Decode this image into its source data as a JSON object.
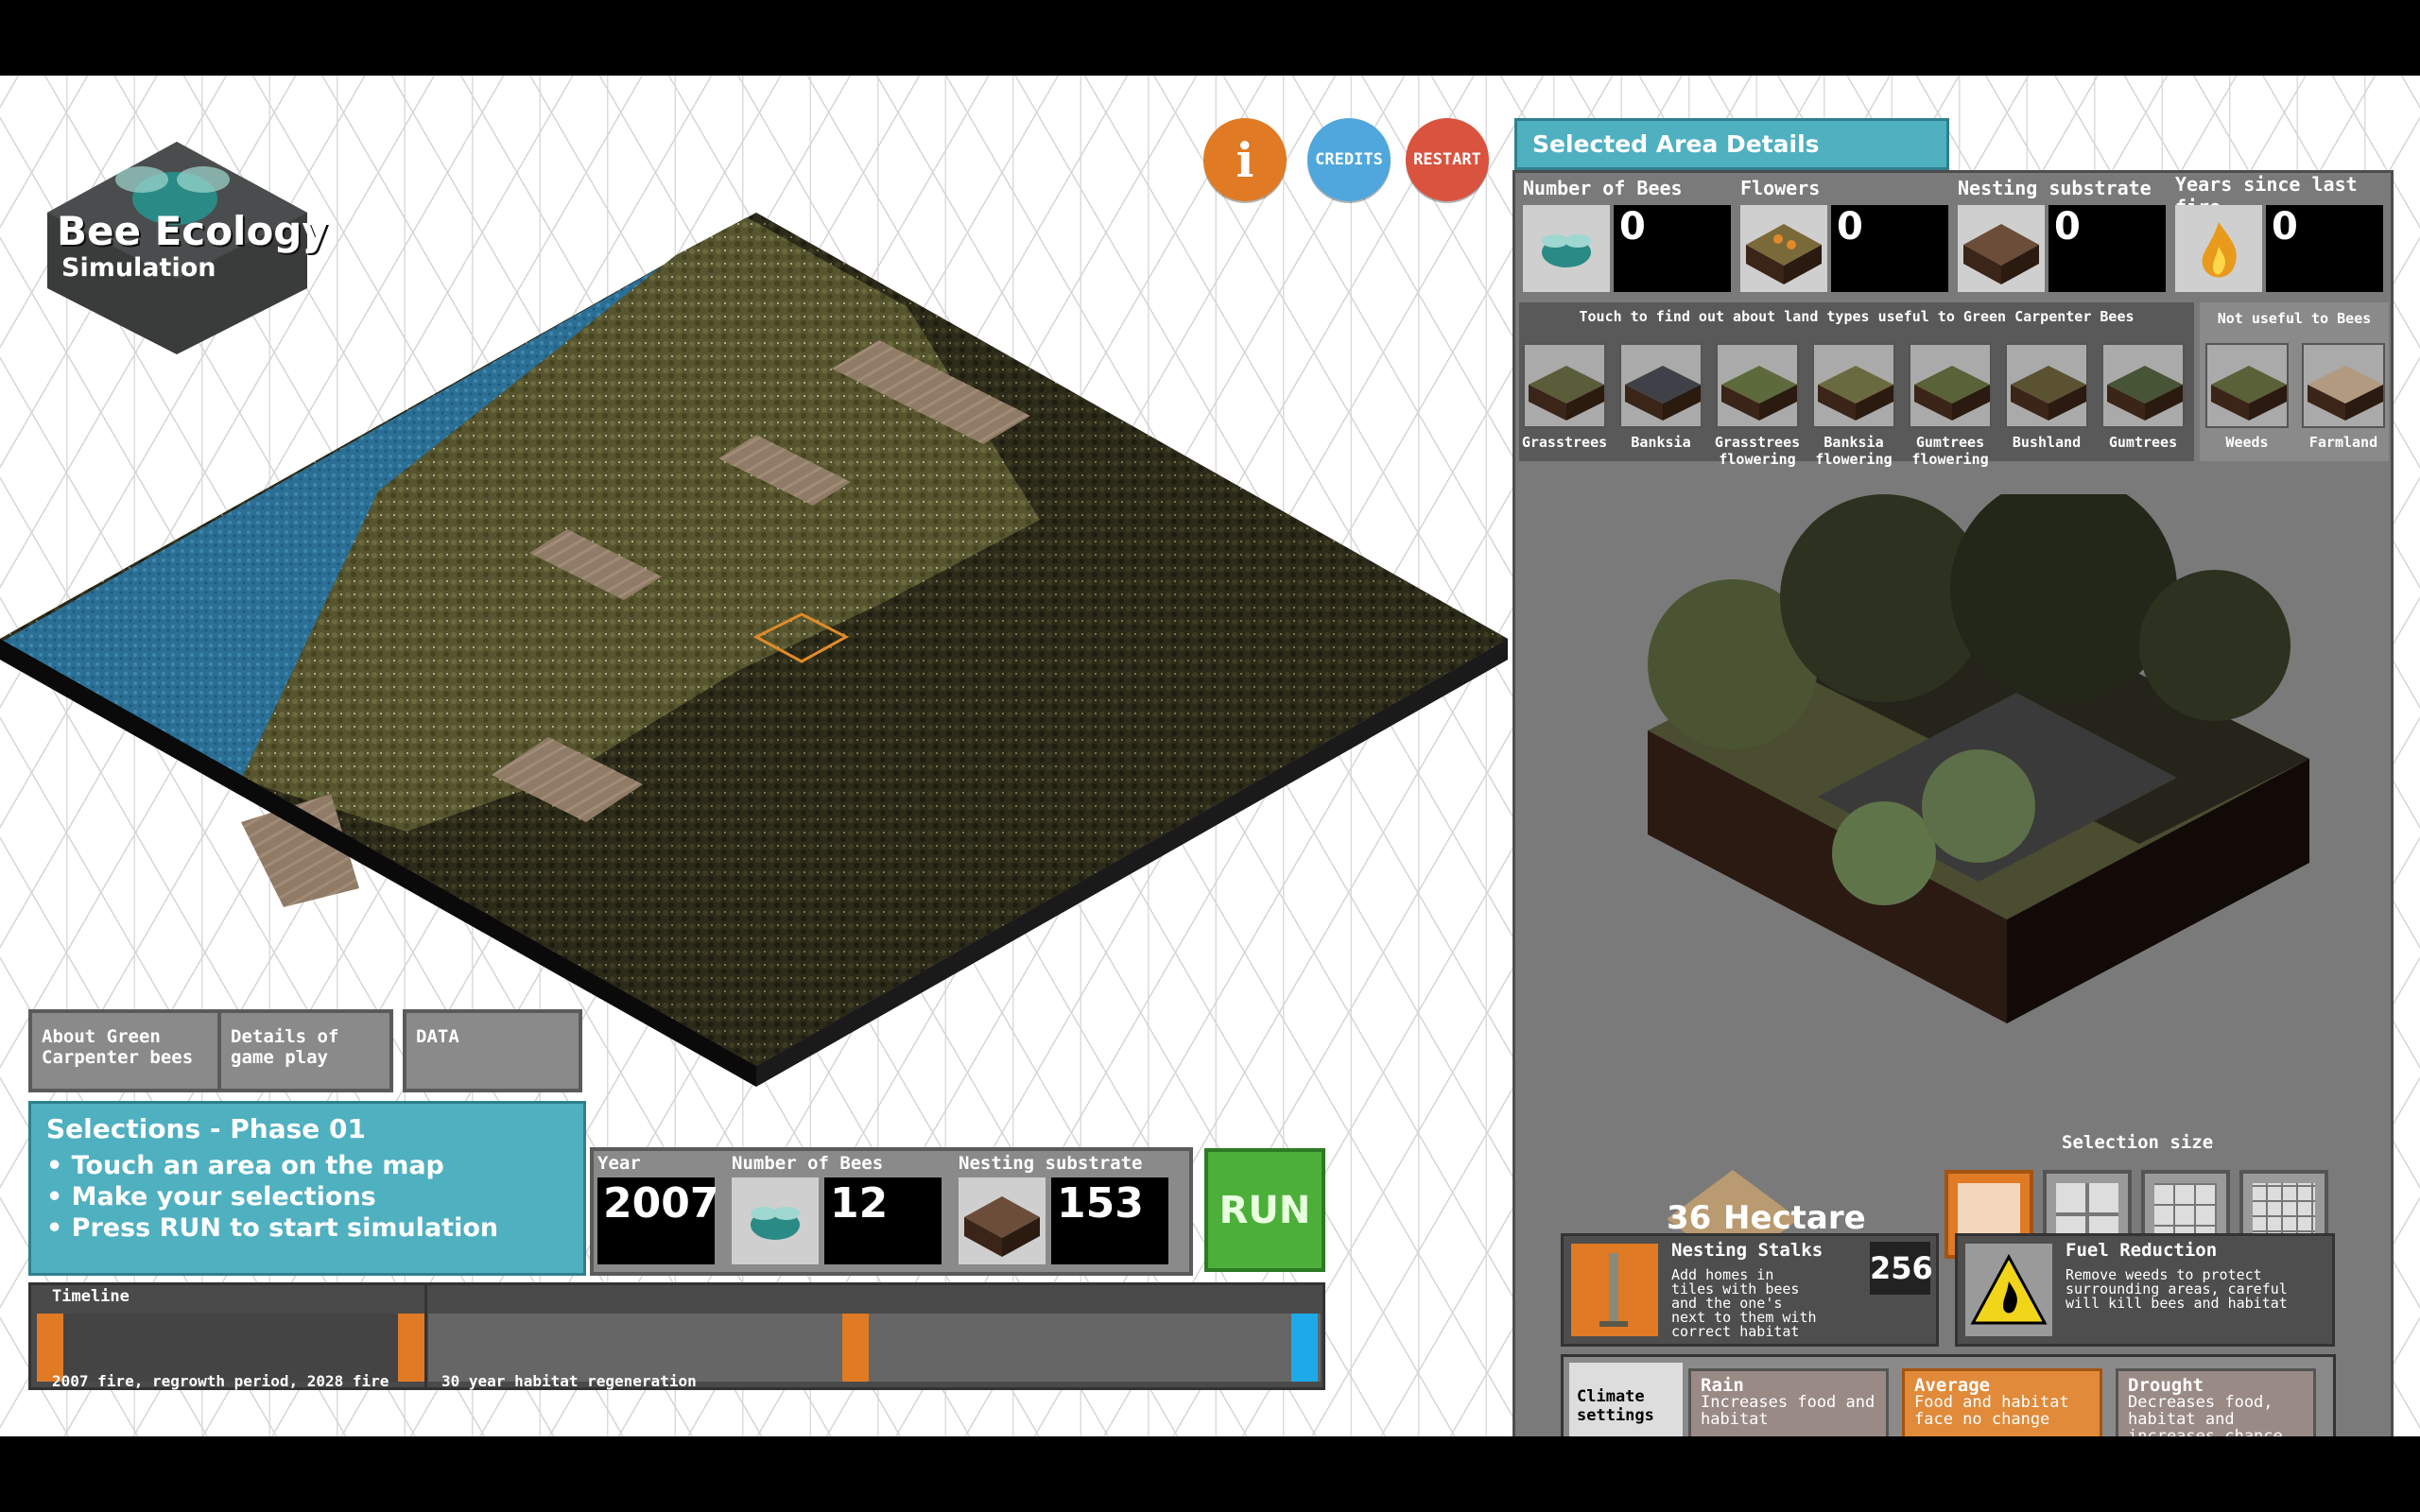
{
  "logo": {
    "title": "Bee Ecology",
    "subtitle": "Simulation"
  },
  "top_buttons": {
    "info": "i",
    "credits": "CREDITS",
    "restart": "RESTART"
  },
  "tabs": [
    {
      "label_line1": "About Green",
      "label_line2": "Carpenter bees"
    },
    {
      "label_line1": "Details of",
      "label_line2": "game play"
    },
    {
      "label_line1": "DATA",
      "label_line2": ""
    }
  ],
  "selections": {
    "title": "Selections - Phase 01",
    "items": [
      "• Touch an area on the map",
      "• Make your selections",
      "• Press RUN to start simulation"
    ]
  },
  "stats": {
    "year_label": "Year",
    "year": "2007",
    "bees_label": "Number of Bees",
    "bees": "12",
    "nesting_label": "Nesting substrate",
    "nesting": "153"
  },
  "run_label": "RUN",
  "timeline": {
    "title": "Timeline",
    "left_caption": "2007 fire, regrowth period, 2028 fire",
    "right_caption": "30 year habitat regeneration"
  },
  "panel": {
    "header": "Selected Area Details",
    "counters": [
      {
        "label": "Number of Bees",
        "value": "0",
        "icon": "bee-icon"
      },
      {
        "label": "Flowers",
        "value": "0",
        "icon": "flowers-icon"
      },
      {
        "label": "Nesting substrate",
        "value": "0",
        "icon": "nesting-icon"
      },
      {
        "label": "Years since last fire",
        "value": "0",
        "icon": "fire-icon"
      }
    ],
    "useful_title": "Touch to find out about land types useful to Green Carpenter Bees",
    "not_useful_title": "Not useful to Bees",
    "land_types": [
      {
        "line1": "Grasstrees",
        "line2": ""
      },
      {
        "line1": "Banksia",
        "line2": ""
      },
      {
        "line1": "Grasstrees",
        "line2": "flowering"
      },
      {
        "line1": "Banksia",
        "line2": "flowering"
      },
      {
        "line1": "Gumtrees",
        "line2": "flowering"
      },
      {
        "line1": "Bushland",
        "line2": ""
      },
      {
        "line1": "Gumtrees",
        "line2": ""
      }
    ],
    "not_useful_types": [
      {
        "line1": "Weeds"
      },
      {
        "line1": "Farmland"
      }
    ],
    "selection_size_label": "Selection size",
    "area_value": "36",
    "area_unit": "Hectare",
    "nesting_stalks": {
      "title": "Nesting Stalks",
      "desc": "Add homes in tiles with bees and the one's next to them with correct habitat",
      "count": "256"
    },
    "fuel_reduction": {
      "title": "Fuel Reduction",
      "desc": "Remove weeds to protect surrounding areas, careful will kill bees and habitat"
    },
    "climate_label": "Climate settings",
    "climate_options": [
      {
        "title": "Rain",
        "desc": "Increases food and habitat"
      },
      {
        "title": "Average",
        "desc": "Food and habitat face no change"
      },
      {
        "title": "Drought",
        "desc": "Decreases food, habitat and increases chance of fire"
      }
    ]
  },
  "colors": {
    "accent_teal": "#4fb0c0",
    "run_green": "#4caf3a",
    "orange": "#e07a24",
    "blue": "#4fa7dd",
    "red": "#d9533f"
  }
}
